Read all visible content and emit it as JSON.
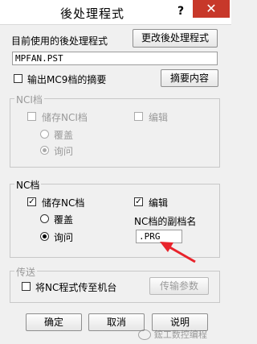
{
  "window": {
    "title": "後处理程式",
    "help": "?",
    "close": "✕"
  },
  "top": {
    "current_label": "目前使用的後处理程式",
    "change_button": "更改後处理程式",
    "current_value": "MPFAN.PST",
    "mc9_label": "输出MC9档的摘要",
    "summary_button": "摘要内容"
  },
  "nci_group": {
    "title": "NCI档",
    "store_label": "储存NCI档",
    "edit_label": "编辑",
    "overwrite_label": "覆盖",
    "ask_label": "询问"
  },
  "nc_group": {
    "title": "NC档",
    "store_label": "储存NC档",
    "edit_label": "编辑",
    "overwrite_label": "覆盖",
    "ask_label": "询问",
    "ext_label": "NC档的副档名",
    "ext_value": ".PRG"
  },
  "transfer_group": {
    "title": "传送",
    "send_label": "将NC程式传至机台",
    "params_button": "传输参数"
  },
  "buttons": {
    "ok": "确定",
    "cancel": "取消",
    "help": "说明"
  },
  "watermark": "鋐工数控编程",
  "colors": {
    "arrow": "#e8232b",
    "close": "#c7382a"
  }
}
